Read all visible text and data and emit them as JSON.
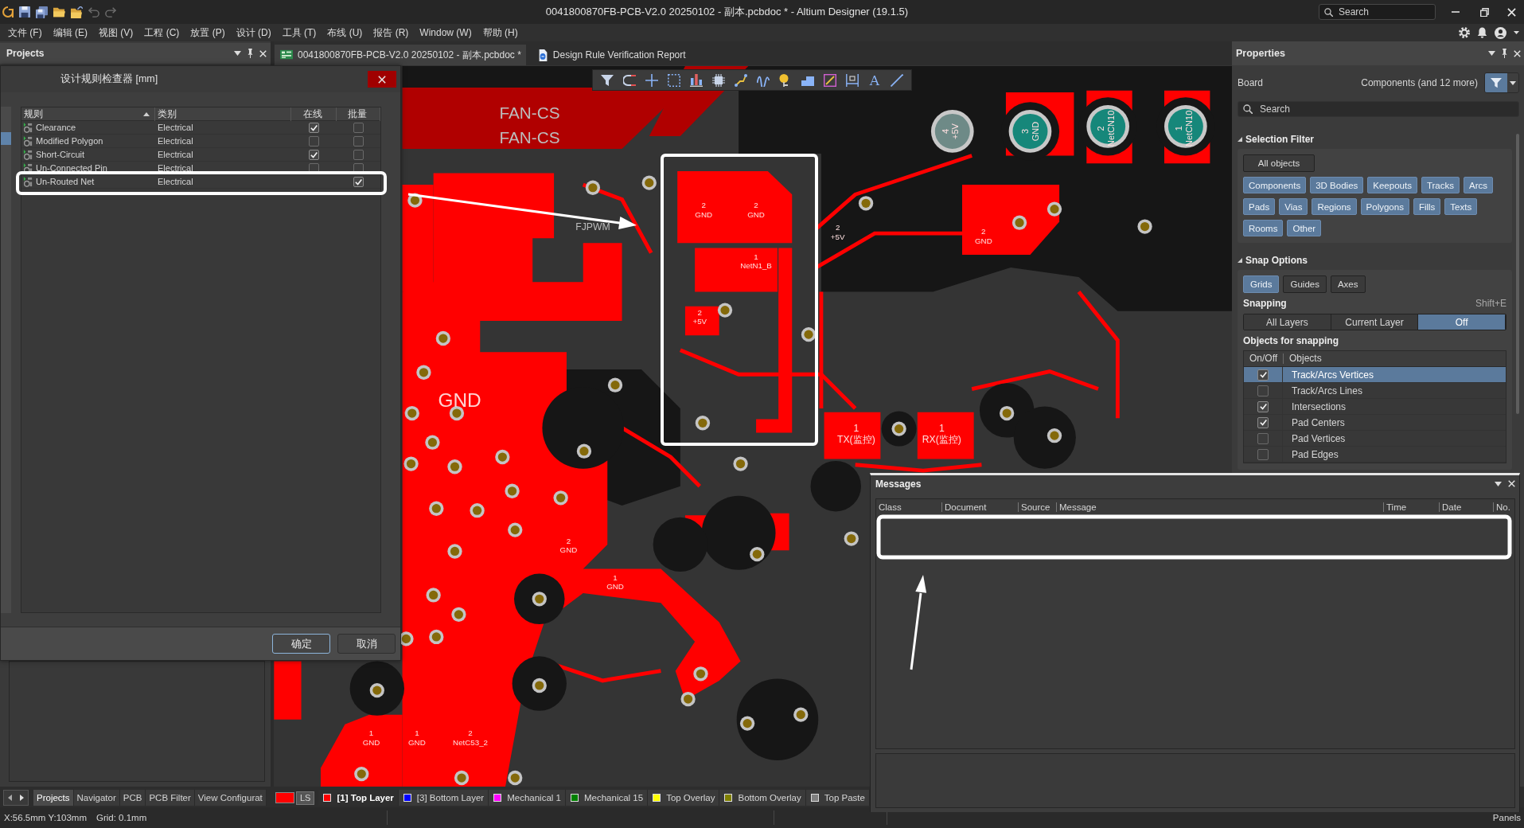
{
  "title_bar": {
    "title": "0041800870FB-PCB-V2.0 20250102 - 副本.pcbdoc * - Altium Designer (19.1.5)",
    "search": {
      "placeholder": "Search"
    }
  },
  "menu": [
    "文件 (F)",
    "编辑 (E)",
    "视图 (V)",
    "工程 (C)",
    "放置 (P)",
    "设计 (D)",
    "工具 (T)",
    "布线 (U)",
    "报告 (R)",
    "Window (W)",
    "帮助 (H)"
  ],
  "projects_panel": {
    "title": "Projects",
    "tabs": [
      {
        "label": "Projects",
        "selected": true
      },
      {
        "label": "Navigator",
        "selected": false
      },
      {
        "label": "PCB",
        "selected": false
      },
      {
        "label": "PCB Filter",
        "selected": false
      },
      {
        "label": "View Configurat",
        "selected": false
      }
    ]
  },
  "document_tabs": [
    {
      "kind": "pcb",
      "label": "0041800870FB-PCB-V2.0 20250102 - 副本.pcbdoc *",
      "selected": true
    },
    {
      "kind": "report",
      "label": "Design Rule Verification Report",
      "selected": false
    }
  ],
  "drc_dialog": {
    "title": "设计规则检查器 [mm]",
    "columns": [
      "规则",
      "类别",
      "在线",
      "批量"
    ],
    "rows": [
      {
        "rule": "Clearance",
        "category": "Electrical",
        "online_available": true,
        "online": true,
        "batch": false
      },
      {
        "rule": "Modified Polygon",
        "category": "Electrical",
        "online_available": true,
        "online": false,
        "batch": false
      },
      {
        "rule": "Short-Circuit",
        "category": "Electrical",
        "online_available": true,
        "online": true,
        "batch": false
      },
      {
        "rule": "Un-Connected Pin",
        "category": "Electrical",
        "online_available": true,
        "online": false,
        "batch": false
      },
      {
        "rule": "Un-Routed Net",
        "category": "Electrical",
        "online_available": false,
        "batch": true
      }
    ],
    "buttons": [
      {
        "label": "确定",
        "focused": true
      },
      {
        "label": "取消",
        "focused": false
      }
    ]
  },
  "pcb_toolbar": {
    "text_glyph": "A"
  },
  "pcb_labels": [
    {
      "kind": "silk",
      "text": "FAN-CS"
    },
    {
      "kind": "silk",
      "text": "FAN-CS"
    },
    {
      "kind": "silk",
      "text": "FJPWM"
    },
    {
      "kind": "net",
      "text": "GND"
    },
    {
      "kind": "pad",
      "pin": "2",
      "net": "GND"
    },
    {
      "kind": "pad",
      "pin": "2",
      "net": "GND"
    },
    {
      "kind": "pad",
      "pin": "1",
      "net": "NetN1_B"
    },
    {
      "kind": "pad",
      "pin": "2",
      "net": "+5V"
    },
    {
      "kind": "pad",
      "pin": "2",
      "net": "+5V"
    },
    {
      "kind": "pad",
      "pin": "2",
      "net": "GND"
    },
    {
      "kind": "pad",
      "pin": "2",
      "net": "GND"
    },
    {
      "kind": "pad",
      "pin": "1",
      "net": "GND"
    },
    {
      "kind": "pad",
      "pin": "1",
      "net": "GND"
    },
    {
      "kind": "pad",
      "pin": "1",
      "net": "GND"
    },
    {
      "kind": "pad",
      "pin": "1",
      "net": "TX(监控)"
    },
    {
      "kind": "pad",
      "pin": "1",
      "net": "RX(监控)"
    },
    {
      "kind": "pad",
      "pin": "4",
      "net": "+5V"
    },
    {
      "kind": "pad",
      "pin": "3",
      "net": "GND"
    },
    {
      "kind": "pad",
      "pin": "2",
      "net": "NetCN10"
    },
    {
      "kind": "pad",
      "pin": "1",
      "net": "NetCN10"
    },
    {
      "kind": "pad",
      "pin": "2",
      "net": "NetC53_2"
    }
  ],
  "properties": {
    "title": "Properties",
    "object": "Board",
    "filter_summary": "Components (and 12 more)",
    "search": {
      "placeholder": "Search"
    },
    "selection_filter": {
      "title": "Selection Filter",
      "all_objects": {
        "label": "All objects",
        "on": false
      },
      "items": [
        {
          "label": "Components",
          "on": true
        },
        {
          "label": "3D Bodies",
          "on": true
        },
        {
          "label": "Keepouts",
          "on": true
        },
        {
          "label": "Tracks",
          "on": true
        },
        {
          "label": "Arcs",
          "on": true
        },
        {
          "label": "Pads",
          "on": true
        },
        {
          "label": "Vias",
          "on": true
        },
        {
          "label": "Regions",
          "on": true
        },
        {
          "label": "Polygons",
          "on": true
        },
        {
          "label": "Fills",
          "on": true
        },
        {
          "label": "Texts",
          "on": true
        },
        {
          "label": "Rooms",
          "on": true
        },
        {
          "label": "Other",
          "on": true
        }
      ]
    },
    "snap_options": {
      "title": "Snap Options",
      "modes": [
        {
          "label": "Grids",
          "on": true
        },
        {
          "label": "Guides",
          "on": false
        },
        {
          "label": "Axes",
          "on": false
        }
      ],
      "snapping_label": "Snapping",
      "shortcut": "Shift+E",
      "snapping": [
        {
          "label": "All Layers",
          "selected": false
        },
        {
          "label": "Current Layer",
          "selected": false
        },
        {
          "label": "Off",
          "selected": true
        }
      ],
      "objects_title": "Objects for snapping",
      "columns": [
        "On/Off",
        "Objects"
      ],
      "objects": [
        {
          "label": "Track/Arcs Vertices",
          "checked": true,
          "selected": true
        },
        {
          "label": "Track/Arcs Lines",
          "checked": false,
          "selected": false
        },
        {
          "label": "Intersections",
          "checked": true,
          "selected": false
        },
        {
          "label": "Pad Centers",
          "checked": true,
          "selected": false
        },
        {
          "label": "Pad Vertices",
          "checked": false,
          "selected": false
        },
        {
          "label": "Pad Edges",
          "checked": false,
          "selected": false
        }
      ]
    }
  },
  "messages": {
    "title": "Messages",
    "columns": [
      "Class",
      "Document",
      "Source",
      "Message",
      "Time",
      "Date",
      "No."
    ]
  },
  "layer_bar": {
    "shortcut": "LS",
    "layers": [
      {
        "label": "[1] Top Layer",
        "color": "#ff0000",
        "selected": true
      },
      {
        "label": "[3] Bottom Layer",
        "color": "#0000ff",
        "selected": false
      },
      {
        "label": "Mechanical 1",
        "color": "#ff00ff",
        "selected": false
      },
      {
        "label": "Mechanical 15",
        "color": "#008000",
        "selected": false
      },
      {
        "label": "Top Overlay",
        "color": "#ffff00",
        "selected": false
      },
      {
        "label": "Bottom Overlay",
        "color": "#808000",
        "selected": false
      },
      {
        "label": "Top Paste",
        "color": "#808080",
        "selected": false
      }
    ]
  },
  "status_bar": {
    "position": "X:56.5mm Y:103mm",
    "grid": "Grid: 0.1mm",
    "panels_button": "Panels"
  }
}
